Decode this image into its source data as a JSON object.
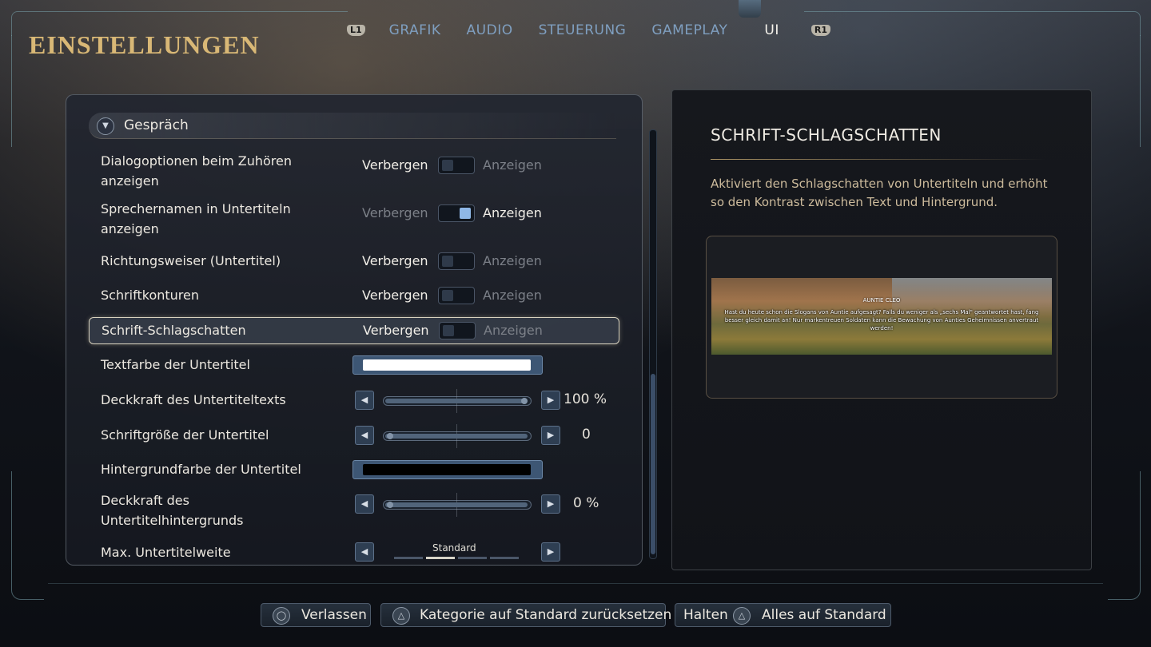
{
  "title": "EINSTELLUNGEN",
  "tabs": {
    "left_hint": "L1",
    "right_hint": "R1",
    "items": [
      "GRAFIK",
      "AUDIO",
      "STEUERUNG",
      "GAMEPLAY",
      "UI"
    ],
    "active": "UI"
  },
  "section": {
    "label": "Gespräch"
  },
  "rows": [
    {
      "label_lines": [
        "Dialogoptionen beim Zuhören",
        "anzeigen"
      ],
      "left": "Verbergen",
      "right": "Anzeigen",
      "value": "Verbergen"
    },
    {
      "label_lines": [
        "Sprechernamen in Untertiteln",
        "anzeigen"
      ],
      "left": "Verbergen",
      "right": "Anzeigen",
      "value": "Anzeigen"
    },
    {
      "label": "Richtungsweiser (Untertitel)",
      "left": "Verbergen",
      "right": "Anzeigen",
      "value": "Verbergen"
    },
    {
      "label": "Schriftkonturen",
      "left": "Verbergen",
      "right": "Anzeigen",
      "value": "Verbergen"
    },
    {
      "label": "Schrift-Schlagschatten",
      "left": "Verbergen",
      "right": "Anzeigen",
      "value": "Verbergen",
      "selected": true
    },
    {
      "label": "Textfarbe der Untertitel",
      "color": "#ffffff"
    },
    {
      "label": "Deckkraft des Untertiteltexts",
      "value_text": "100 %",
      "percent": 100
    },
    {
      "label": "Schriftgröße der Untertitel",
      "value_text": "0",
      "percent": 0
    },
    {
      "label": "Hintergrundfarbe der Untertitel",
      "color": "#000000"
    },
    {
      "label_lines": [
        "Deckkraft des",
        "Untertitelhintergrunds"
      ],
      "value_text": "0 %",
      "percent": 0
    },
    {
      "label": "Max. Untertitelweite",
      "value_text": "Standard"
    }
  ],
  "detail": {
    "title": "SCHRIFT-SCHLAGSCHATTEN",
    "description": "Aktiviert den Schlagschatten von Untertiteln und erhöht so den Kontrast zwischen Text und Hintergrund.",
    "preview": {
      "speaker": "AUNTIE CLEO",
      "text": "Hast du heute schon die Slogans von Auntie aufgesagt? Falls du weniger als „sechs Mal\" geantwortet hast, fang besser gleich damit an! Nur markentreuen Soldaten kann die Bewachung von Aunties Geheimnissen anvertraut werden!"
    }
  },
  "footer": {
    "leave": {
      "icon": "circle-button-icon",
      "label": "Verlassen"
    },
    "reset_category": {
      "icon": "triangle-button-icon",
      "label": "Kategorie auf Standard zurücksetzen"
    },
    "reset_all": {
      "prefix": "Halten",
      "icon": "triangle-button-icon",
      "label": "Alles auf Standard"
    }
  },
  "colors": {
    "accent_gold": "#d9b876",
    "tab_inactive": "#7f9fc0",
    "toggle_on": "#8fb7e6"
  }
}
